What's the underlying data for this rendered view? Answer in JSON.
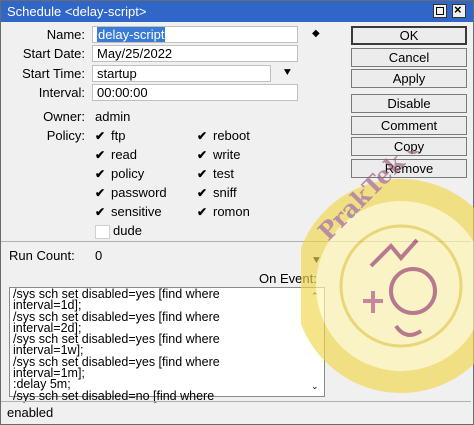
{
  "window": {
    "title": "Schedule <delay-script>"
  },
  "form": {
    "name": {
      "label": "Name:",
      "value": "delay-script"
    },
    "start_date": {
      "label": "Start Date:",
      "value": "May/25/2022"
    },
    "start_time": {
      "label": "Start Time:",
      "value": "startup"
    },
    "interval": {
      "label": "Interval:",
      "value": "00:00:00"
    },
    "owner": {
      "label": "Owner:",
      "value": "admin"
    },
    "policy_label": "Policy:",
    "run_count": {
      "label": "Run Count:",
      "value": "0"
    },
    "on_event_label": "On Event:"
  },
  "policies": [
    {
      "name": "ftp",
      "checked": true
    },
    {
      "name": "reboot",
      "checked": true
    },
    {
      "name": "read",
      "checked": true
    },
    {
      "name": "write",
      "checked": true
    },
    {
      "name": "policy",
      "checked": true
    },
    {
      "name": "test",
      "checked": true
    },
    {
      "name": "password",
      "checked": true
    },
    {
      "name": "sniff",
      "checked": true
    },
    {
      "name": "sensitive",
      "checked": true
    },
    {
      "name": "romon",
      "checked": true
    },
    {
      "name": "dude",
      "checked": false
    }
  ],
  "buttons": {
    "ok": "OK",
    "cancel": "Cancel",
    "apply": "Apply",
    "disable": "Disable",
    "comment": "Comment",
    "copy": "Copy",
    "remove": "Remove"
  },
  "script": "/sys sch set disabled=yes [find where\ninterval=1d];\n/sys sch set disabled=yes [find where\ninterval=2d];\n/sys sch set disabled=yes [find where\ninterval=1w];\n/sys sch set disabled=yes [find where\ninterval=1m];\n:delay 5m;\n/sys sch set disabled=no [find where",
  "status": "enabled",
  "watermark": {
    "text": "PrakTek Otodidak Elektro"
  },
  "colors": {
    "titlebar": "#2f66c8",
    "selection": "#3a7bd5",
    "watermark": "#f4e04d"
  }
}
